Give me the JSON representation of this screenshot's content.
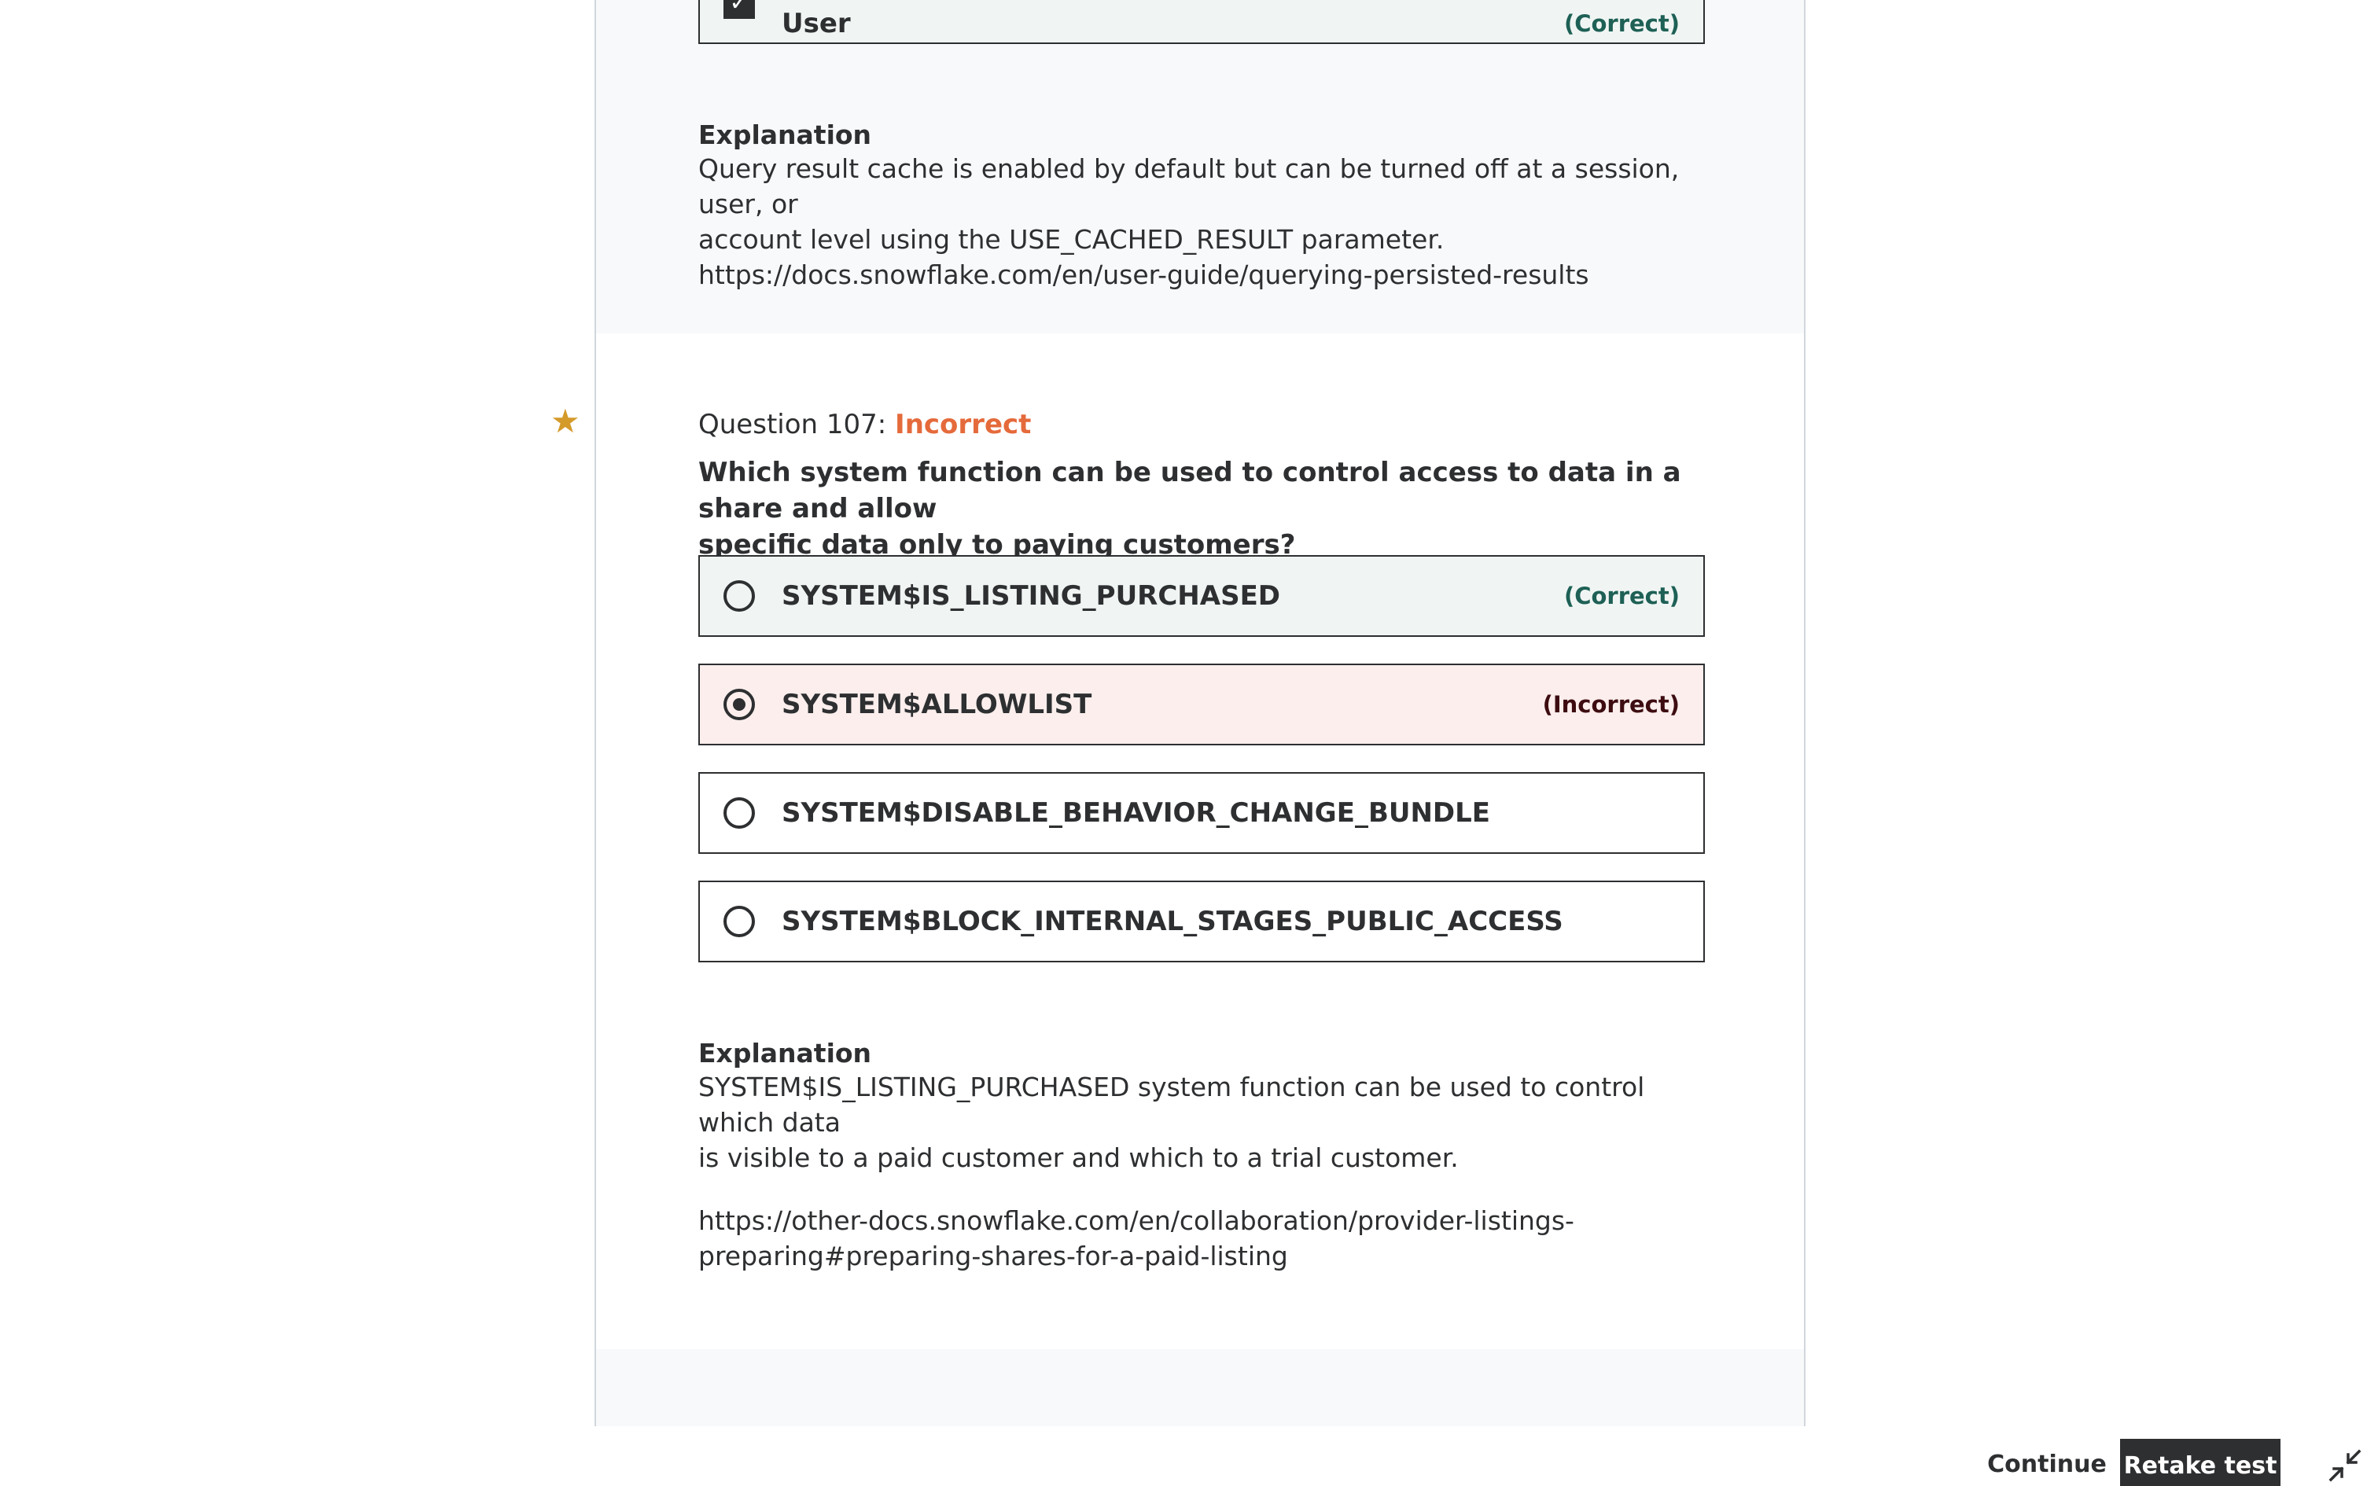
{
  "previous_question": {
    "answer": {
      "label": "User",
      "status": "(Correct)",
      "check": "✓"
    },
    "explanation": {
      "heading": "Explanation",
      "lines": [
        "Query result cache is enabled by default but can be turned off at a session, user, or",
        "account level using the USE_CACHED_RESULT parameter.",
        "https://docs.snowflake.com/en/user-guide/querying-persisted-results"
      ]
    }
  },
  "question": {
    "star": "★",
    "number_label": "Question 107: ",
    "result": "Incorrect",
    "text_lines": [
      "Which system function can be used to control access to data in a share and allow",
      "specific data only to paying customers?"
    ],
    "answers": [
      {
        "label": "SYSTEM$IS_LISTING_PURCHASED",
        "status": "(Correct)",
        "selected": false
      },
      {
        "label": "SYSTEM$ALLOWLIST",
        "status": "(Incorrect)",
        "selected": true
      },
      {
        "label": "SYSTEM$DISABLE_BEHAVIOR_CHANGE_BUNDLE",
        "status": "",
        "selected": false
      },
      {
        "label": "SYSTEM$BLOCK_INTERNAL_STAGES_PUBLIC_ACCESS",
        "status": "",
        "selected": false
      }
    ],
    "explanation": {
      "heading": "Explanation",
      "lines": [
        "SYSTEM$IS_LISTING_PURCHASED system function can be used to control which data",
        "is visible to a paid customer and which to a trial customer."
      ],
      "link_lines": [
        "https://other-docs.snowflake.com/en/collaboration/provider-listings-",
        "preparing#preparing-shares-for-a-paid-listing"
      ]
    }
  },
  "footer": {
    "continue_label": "Continue",
    "retake_label": "Retake test",
    "collapse_icon": "collapse-icon"
  },
  "colors": {
    "incorrect_accent": "#e56a3b",
    "correct_text": "#1e6055",
    "correct_bg": "#f0f5f3",
    "incorrect_bg": "#fbeeec",
    "star": "#d49a2a"
  }
}
